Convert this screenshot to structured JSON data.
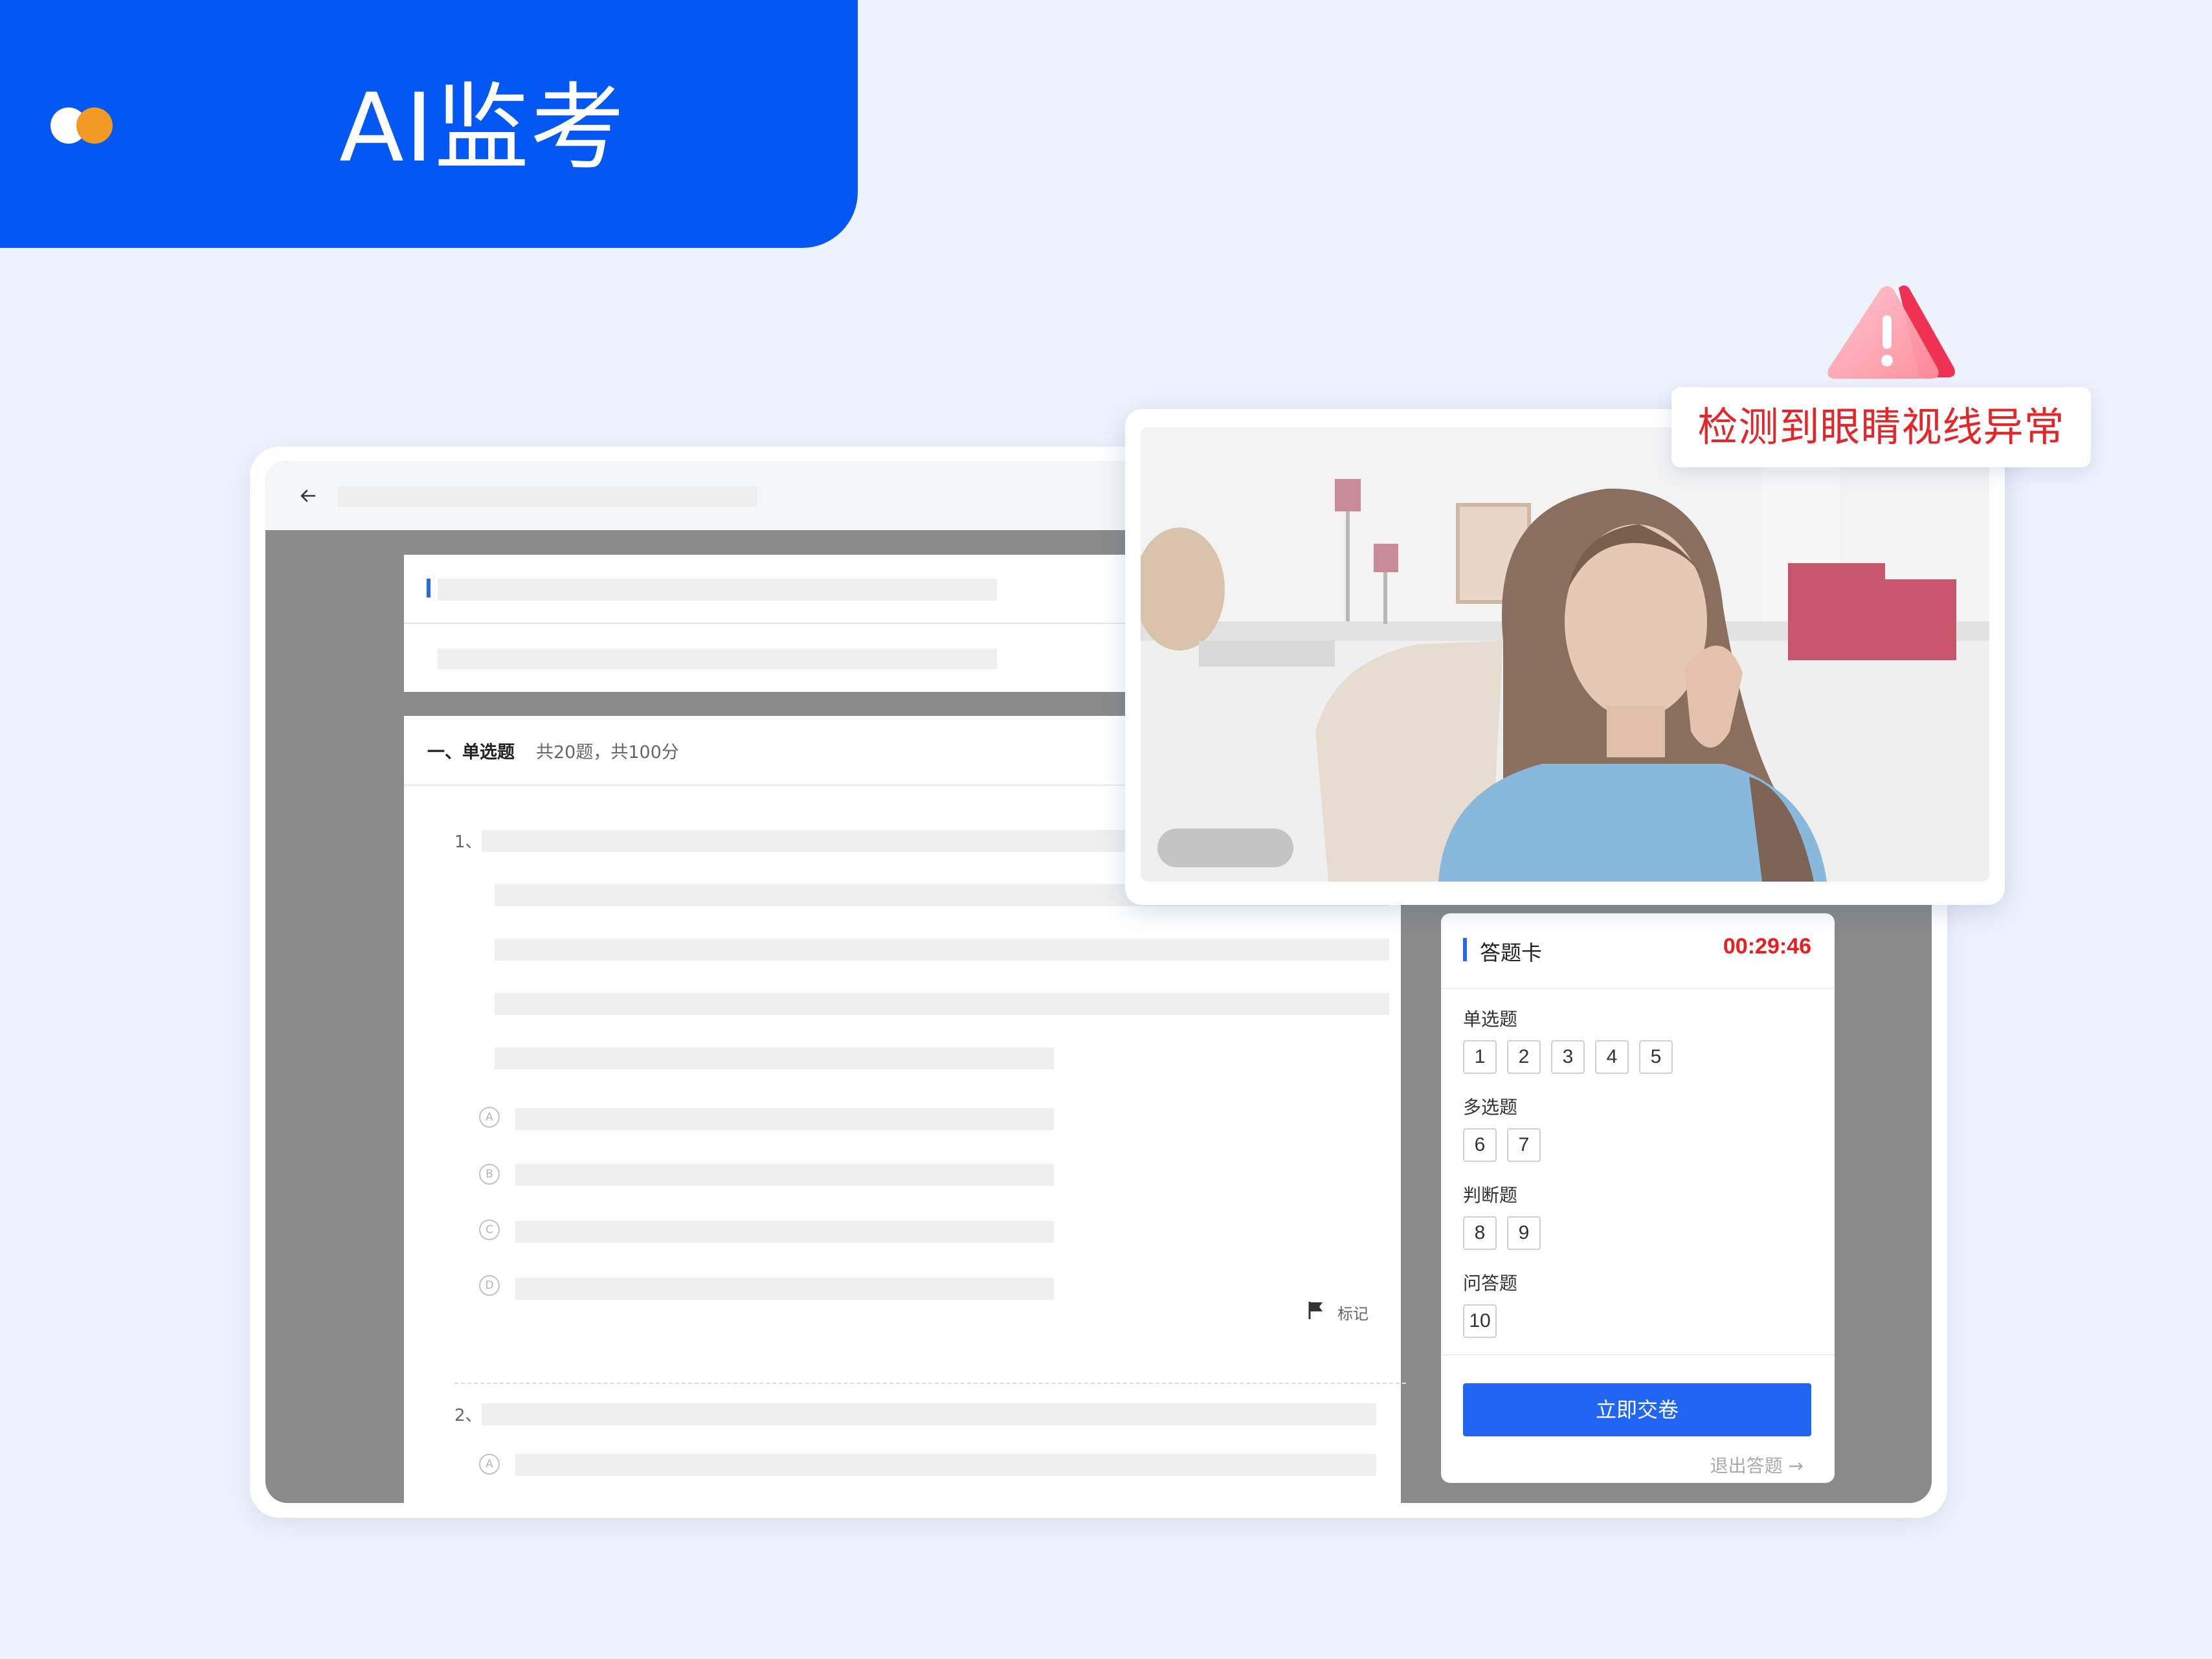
{
  "hero": {
    "title": "AI监考"
  },
  "exam": {
    "section_title": "一、单选题",
    "section_meta": "共20题，共100分",
    "question_1_num": "1、",
    "question_2_num": "2、",
    "options": [
      "A",
      "B",
      "C",
      "D"
    ],
    "mark_label": "标记"
  },
  "answer_card": {
    "title": "答题卡",
    "timer": "00:29:46",
    "groups": [
      {
        "label": "单选题",
        "items": [
          "1",
          "2",
          "3",
          "4",
          "5"
        ]
      },
      {
        "label": "多选题",
        "items": [
          "6",
          "7"
        ]
      },
      {
        "label": "判断题",
        "items": [
          "8",
          "9"
        ]
      },
      {
        "label": "问答题",
        "items": [
          "10"
        ]
      }
    ],
    "submit_label": "立即交卷",
    "exit_label": "退出答题 →"
  },
  "alert": {
    "text": "检测到眼睛视线异常"
  },
  "colors": {
    "brand": "#0358f3",
    "accent": "#f39a24",
    "danger": "#e4262b",
    "button": "#2166f2"
  },
  "icons": [
    "back-arrow-icon",
    "flag-icon",
    "warning-triangle-icon"
  ]
}
